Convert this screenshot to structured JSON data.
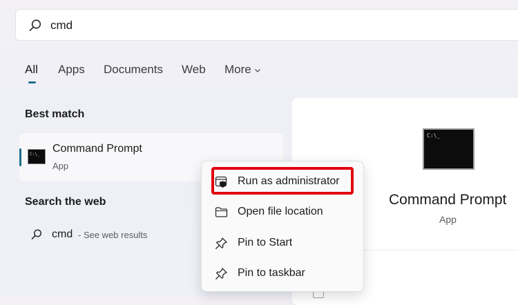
{
  "search": {
    "query": "cmd"
  },
  "tabs": [
    {
      "label": "All"
    },
    {
      "label": "Apps"
    },
    {
      "label": "Documents"
    },
    {
      "label": "Web"
    },
    {
      "label": "More"
    }
  ],
  "best_match": {
    "heading": "Best match",
    "item": {
      "title": "Command Prompt",
      "subtitle": "App",
      "icon_text": "C:\\_"
    }
  },
  "search_web": {
    "heading": "Search the web",
    "term": "cmd",
    "suffix": "- See web results"
  },
  "preview": {
    "title": "Command Prompt",
    "subtitle": "App",
    "icon_text": "C:\\_"
  },
  "context_menu": {
    "items": [
      {
        "label": "Run as administrator",
        "icon": "shield-window-icon"
      },
      {
        "label": "Open file location",
        "icon": "folder-icon"
      },
      {
        "label": "Pin to Start",
        "icon": "pin-icon"
      },
      {
        "label": "Pin to taskbar",
        "icon": "pin-icon"
      }
    ]
  },
  "colors": {
    "accent": "#1f6f8b",
    "highlight": "#e1000f"
  }
}
